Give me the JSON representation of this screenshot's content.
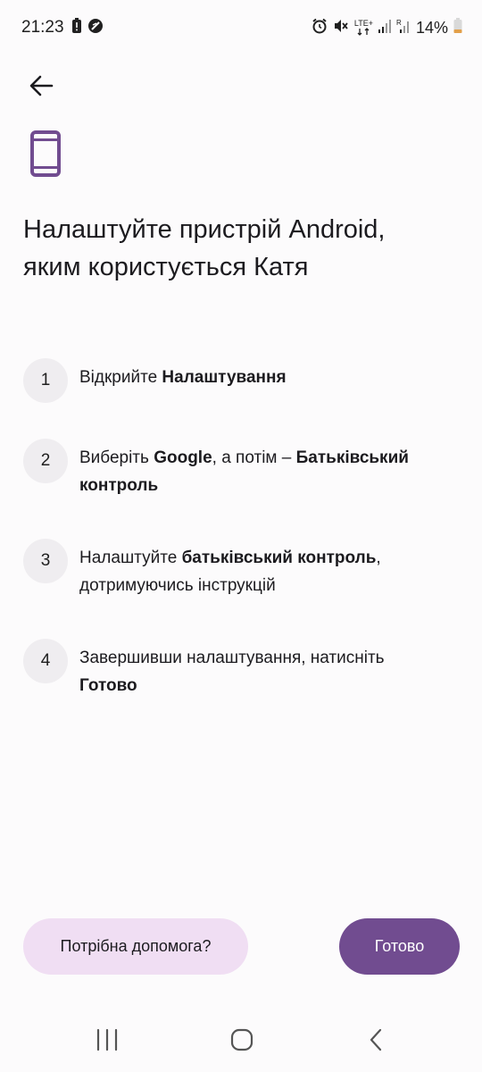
{
  "status_bar": {
    "time": "21:23",
    "battery": "14%",
    "network": "LTE+",
    "left_icons": [
      "alert-battery-icon",
      "do-not-disturb-icon"
    ],
    "right_icons": [
      "alarm-icon",
      "mute-icon",
      "lte-icon",
      "signal-icon",
      "signal-roaming-icon",
      "battery-icon"
    ]
  },
  "header": {
    "back_icon": "arrow-back-icon",
    "device_icon": "phone-device-icon",
    "accent_color": "#714c90",
    "title_line1": "Налаштуйте пристрій Android,",
    "title_line2": "яким користується Катя"
  },
  "steps": [
    {
      "number": "1",
      "parts": [
        "Відкрийте ",
        "Налаштування"
      ]
    },
    {
      "number": "2",
      "parts": [
        "Виберіть ",
        "Google",
        ", а потім – ",
        "Батьківський контроль"
      ]
    },
    {
      "number": "3",
      "parts": [
        "Налаштуйте ",
        "батьківський контроль",
        ",",
        "дотримуючись інструкцій"
      ]
    },
    {
      "number": "4",
      "parts": [
        "Завершивши налаштування, натисніть",
        "Готово"
      ]
    }
  ],
  "actions": {
    "help_label": "Потрібна допомога?",
    "help_color": "#f0def3",
    "done_label": "Готово",
    "done_color": "#714c90"
  },
  "navbar": {
    "recents_icon": "recent-apps-icon",
    "home_icon": "home-icon",
    "back_icon": "nav-back-icon"
  }
}
